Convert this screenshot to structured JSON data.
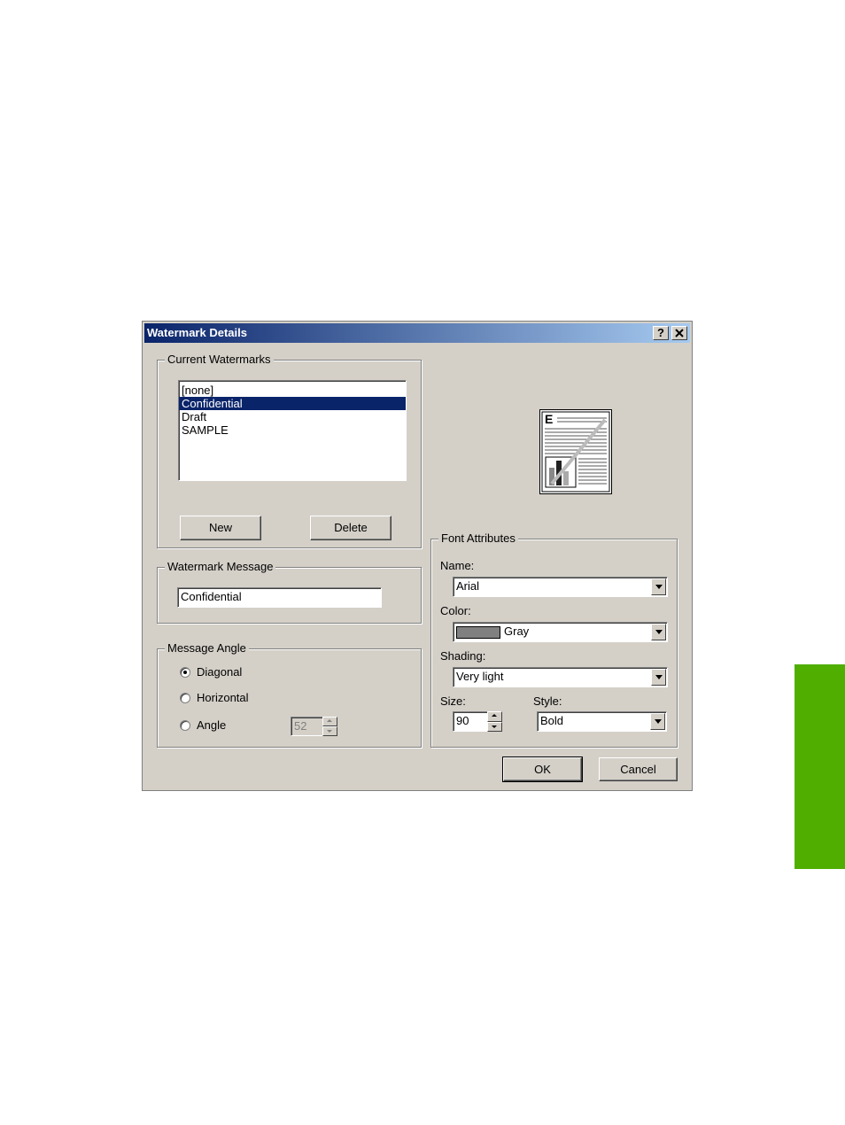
{
  "dialog": {
    "title": "Watermark Details",
    "help_button": "?",
    "close_button": "✕"
  },
  "current_watermarks": {
    "group_label": "Current Watermarks",
    "items": [
      "[none]",
      "Confidential",
      "Draft",
      "SAMPLE"
    ],
    "selected_index": 1,
    "new_label": "New",
    "delete_label": "Delete"
  },
  "watermark_message": {
    "group_label": "Watermark Message",
    "value": "Confidential"
  },
  "message_angle": {
    "group_label": "Message Angle",
    "options": [
      "Diagonal",
      "Horizontal",
      "Angle"
    ],
    "selected": "Diagonal",
    "angle_value": "52"
  },
  "font_attributes": {
    "group_label": "Font Attributes",
    "name_label": "Name:",
    "name_value": "Arial",
    "color_label": "Color:",
    "color_value": "Gray",
    "color_swatch": "#808080",
    "shading_label": "Shading:",
    "shading_value": "Very light",
    "size_label": "Size:",
    "size_value": "90",
    "style_label": "Style:",
    "style_value": "Bold"
  },
  "footer": {
    "ok_label": "OK",
    "cancel_label": "Cancel"
  },
  "preview": {
    "icon": "page-preview-icon",
    "letter": "E"
  },
  "colors": {
    "title_bar": "#0a246a",
    "selection": "#0a246a",
    "side_tab": "#4fae00",
    "dialog_face": "#d4d0c8"
  }
}
